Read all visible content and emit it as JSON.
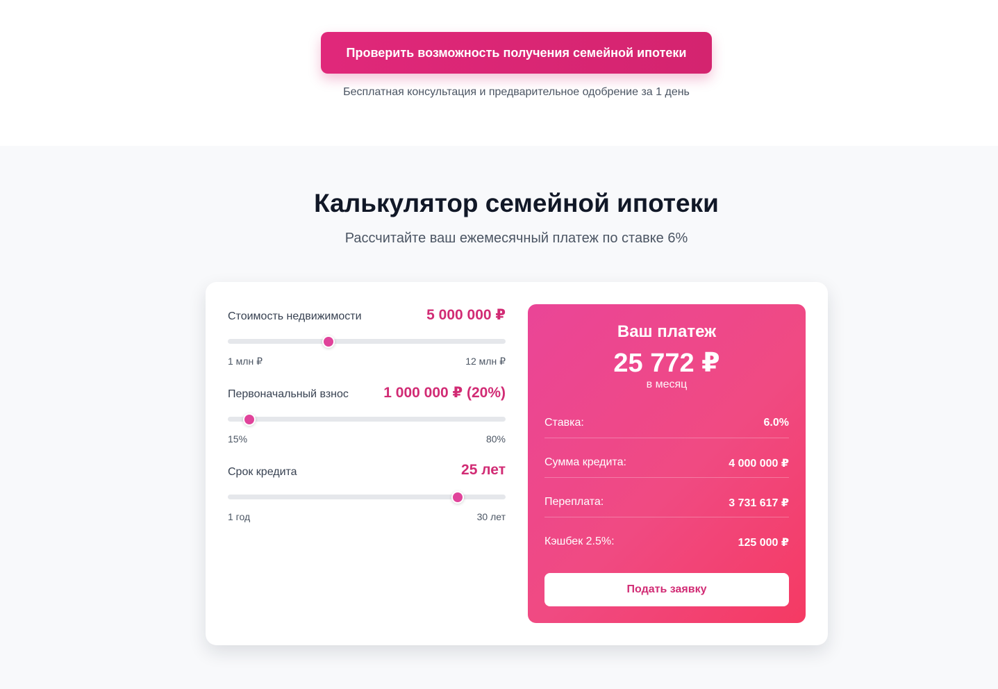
{
  "cta": {
    "button_label": "Проверить возможность получения семейной ипотеки",
    "note": "Бесплатная консультация и предварительное одобрение за 1 день"
  },
  "calculator": {
    "title": "Калькулятор семейной ипотеки",
    "subtitle": "Рассчитайте ваш ежемесячный платеж по ставке 6%",
    "inputs": {
      "price": {
        "label": "Стоимость недвижимости",
        "value_text": "5 000 000 ₽",
        "min_label": "1 млн ₽",
        "max_label": "12 млн ₽",
        "min": 1000000,
        "max": 12000000,
        "value": 5000000
      },
      "down_payment": {
        "label": "Первоначальный взнос",
        "value_text": "1 000 000 ₽ (20%)",
        "min_label": "15%",
        "max_label": "80%",
        "min": 15,
        "max": 80,
        "value": 20
      },
      "term": {
        "label": "Срок кредита",
        "value_text": "25 лет",
        "min_label": "1 год",
        "max_label": "30 лет",
        "min": 1,
        "max": 30,
        "value": 25
      }
    },
    "result": {
      "title": "Ваш платеж",
      "amount": "25 772 ₽",
      "period": "в месяц",
      "rows": [
        {
          "label": "Ставка:",
          "value": "6.0%"
        },
        {
          "label": "Сумма кредита:",
          "value": "4 000 000 ₽"
        },
        {
          "label": "Переплата:",
          "value": "3 731 617 ₽"
        },
        {
          "label": "Кэшбек 2.5%:",
          "value": "125 000 ₽"
        }
      ],
      "apply_label": "Подать заявку"
    },
    "colors": {
      "accent": "#d12b74",
      "slider_thumb": "#e0439a",
      "result_gradient_start": "#ea4597",
      "result_gradient_end": "#f53a63"
    }
  }
}
